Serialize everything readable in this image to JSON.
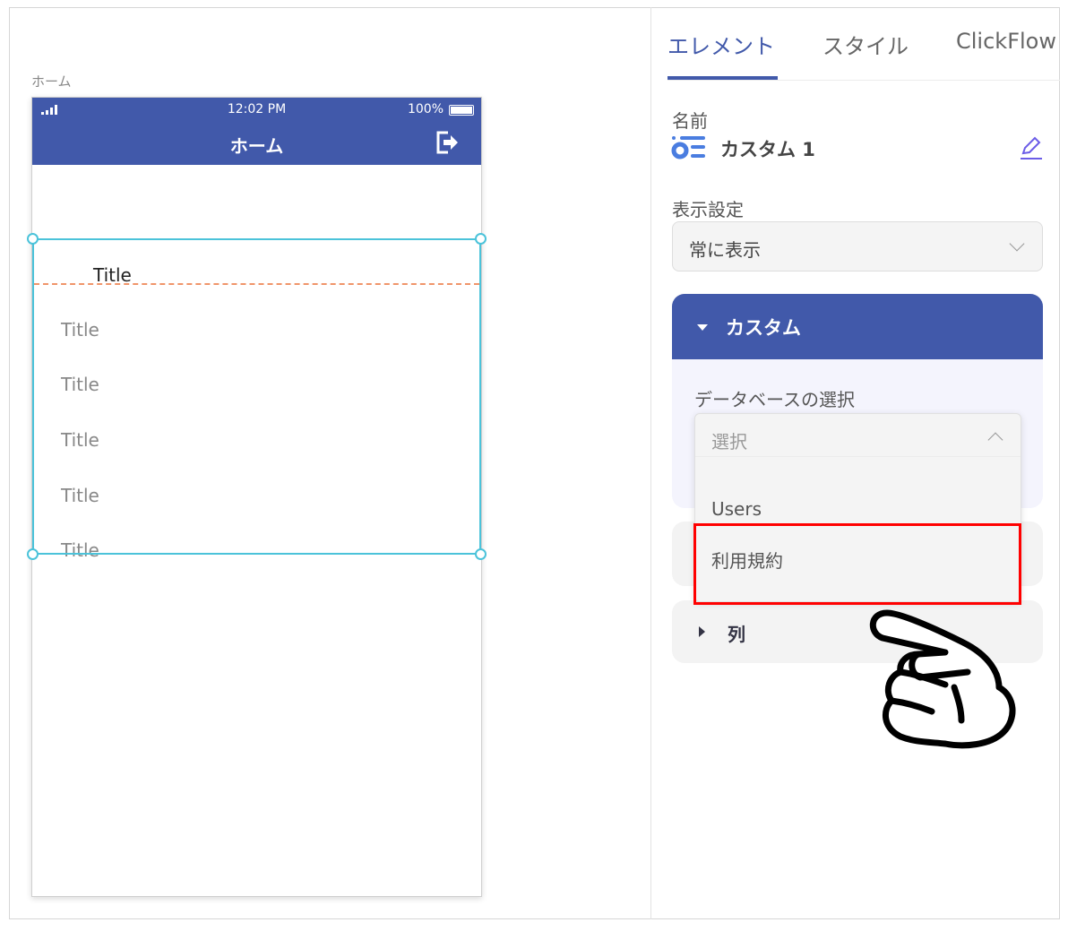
{
  "canvas": {
    "screen_label": "ホーム"
  },
  "phone": {
    "status_time": "12:02 PM",
    "battery": "100%",
    "title": "ホーム",
    "rows": [
      "Title",
      "Title",
      "Title",
      "Title",
      "Title",
      "Title"
    ]
  },
  "tabs": [
    {
      "label": "エレメント"
    },
    {
      "label": "スタイル"
    },
    {
      "label": "ClickFlow"
    }
  ],
  "panel": {
    "name_label": "名前",
    "name_value": "カスタム 1",
    "visibility_label": "表示設定",
    "visibility_value": "常に表示",
    "section_title": "カスタム",
    "db_label": "データベースの選択",
    "db_placeholder": "選択",
    "db_options": [
      "Users",
      "利用規約"
    ],
    "columns_title": "列"
  },
  "colors": {
    "brand": "#4159AA",
    "selection": "#4BC3DA",
    "highlight": "#FF0000"
  }
}
